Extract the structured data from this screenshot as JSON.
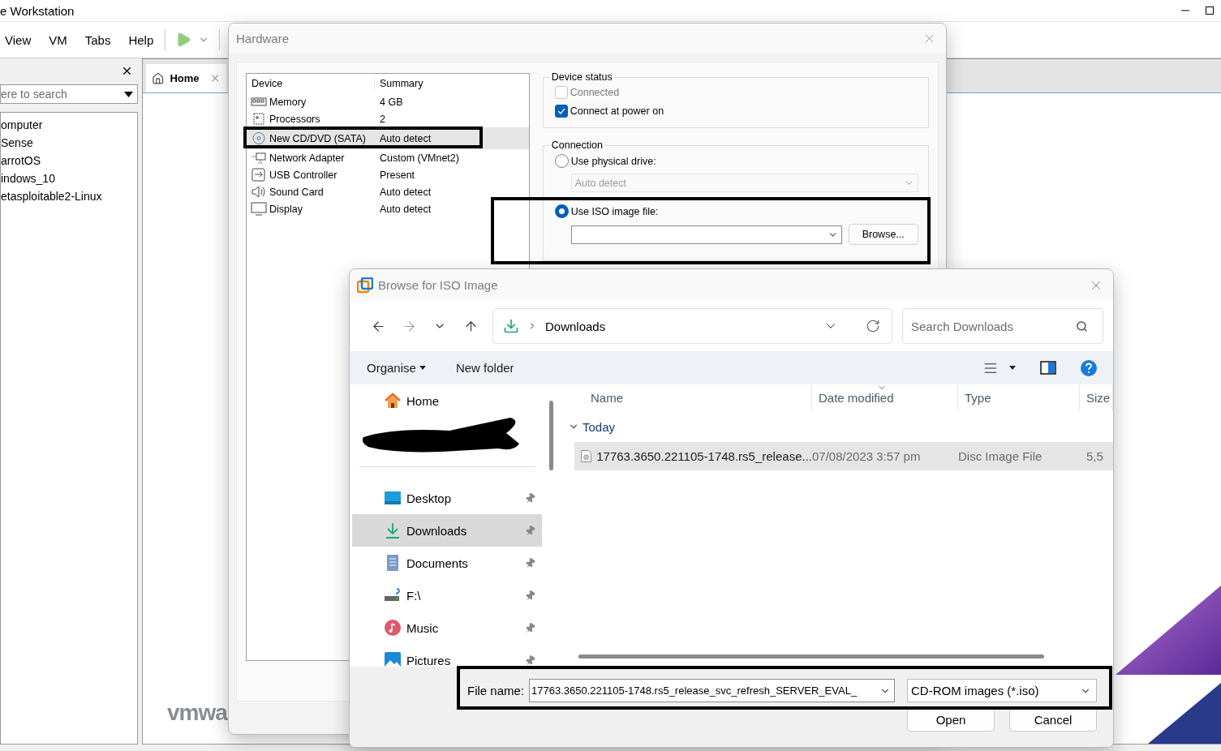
{
  "main_window": {
    "title": "e Workstation",
    "menu": [
      "View",
      "VM",
      "Tabs",
      "Help"
    ],
    "library": {
      "search_placeholder": "ere to search",
      "items": [
        "omputer",
        "Sense",
        "arrotOS",
        "indows_10",
        "etasploitable2-Linux"
      ]
    },
    "tabs": [
      {
        "label": "Home",
        "selected": true
      }
    ],
    "logo": "vmwa"
  },
  "hardware_dialog": {
    "title": "Hardware",
    "columns": [
      "Device",
      "Summary"
    ],
    "devices": [
      {
        "kind": "memory",
        "name": "Memory",
        "summary": "4 GB",
        "selected": false
      },
      {
        "kind": "processor",
        "name": "Processors",
        "summary": "2",
        "selected": false
      },
      {
        "kind": "disc",
        "name": "New CD/DVD (SATA)",
        "summary": "Auto detect",
        "selected": true
      },
      {
        "kind": "network",
        "name": "Network Adapter",
        "summary": "Custom (VMnet2)",
        "selected": false
      },
      {
        "kind": "usb",
        "name": "USB Controller",
        "summary": "Present",
        "selected": false
      },
      {
        "kind": "sound",
        "name": "Sound Card",
        "summary": "Auto detect",
        "selected": false
      },
      {
        "kind": "display",
        "name": "Display",
        "summary": "Auto detect",
        "selected": false
      }
    ],
    "device_status": {
      "title": "Device status",
      "options": [
        {
          "label": "Connected",
          "checked": false,
          "disabled": true
        },
        {
          "label": "Connect at power on",
          "checked": true,
          "disabled": false
        }
      ]
    },
    "connection": {
      "title": "Connection",
      "options": [
        {
          "kind": "drive",
          "label": "Use physical drive:",
          "selected": false
        },
        {
          "kind": "iso",
          "label": "Use ISO image file:",
          "selected": true
        }
      ],
      "drive_value": "Auto detect",
      "browse_button": "Browse..."
    }
  },
  "file_dialog": {
    "title": "Browse for ISO Image",
    "location": "Downloads",
    "search_placeholder": "Search Downloads",
    "toolbar": {
      "organise": "Organise",
      "new_folder": "New folder"
    },
    "nav_items": [
      {
        "kind": "home",
        "label": "Home",
        "pinned": false,
        "selected": false
      },
      {
        "kind": "desktop",
        "label": "Desktop",
        "pinned": true,
        "selected": false
      },
      {
        "kind": "downloads",
        "label": "Downloads",
        "pinned": true,
        "selected": true
      },
      {
        "kind": "documents",
        "label": "Documents",
        "pinned": true,
        "selected": false
      },
      {
        "kind": "drive",
        "label": "F:\\",
        "pinned": true,
        "selected": false
      },
      {
        "kind": "music",
        "label": "Music",
        "pinned": true,
        "selected": false
      },
      {
        "kind": "pictures",
        "label": "Pictures",
        "pinned": true,
        "selected": false
      }
    ],
    "columns": [
      "Name",
      "Date modified",
      "Type",
      "Size"
    ],
    "groups": [
      {
        "label": "Today",
        "expanded": true,
        "files": [
          {
            "name": "17763.3650.221105-1748.rs5_release...",
            "date": "07/08/2023 3:57 pm",
            "type": "Disc Image File",
            "size": "5,5",
            "selected": true
          }
        ]
      }
    ],
    "file_name_label": "File name:",
    "file_name": "17763.3650.221105-1748.rs5_release_svc_refresh_SERVER_EVAL_",
    "file_type": "CD-ROM images (*.iso)",
    "buttons": [
      "Open",
      "Cancel"
    ]
  }
}
